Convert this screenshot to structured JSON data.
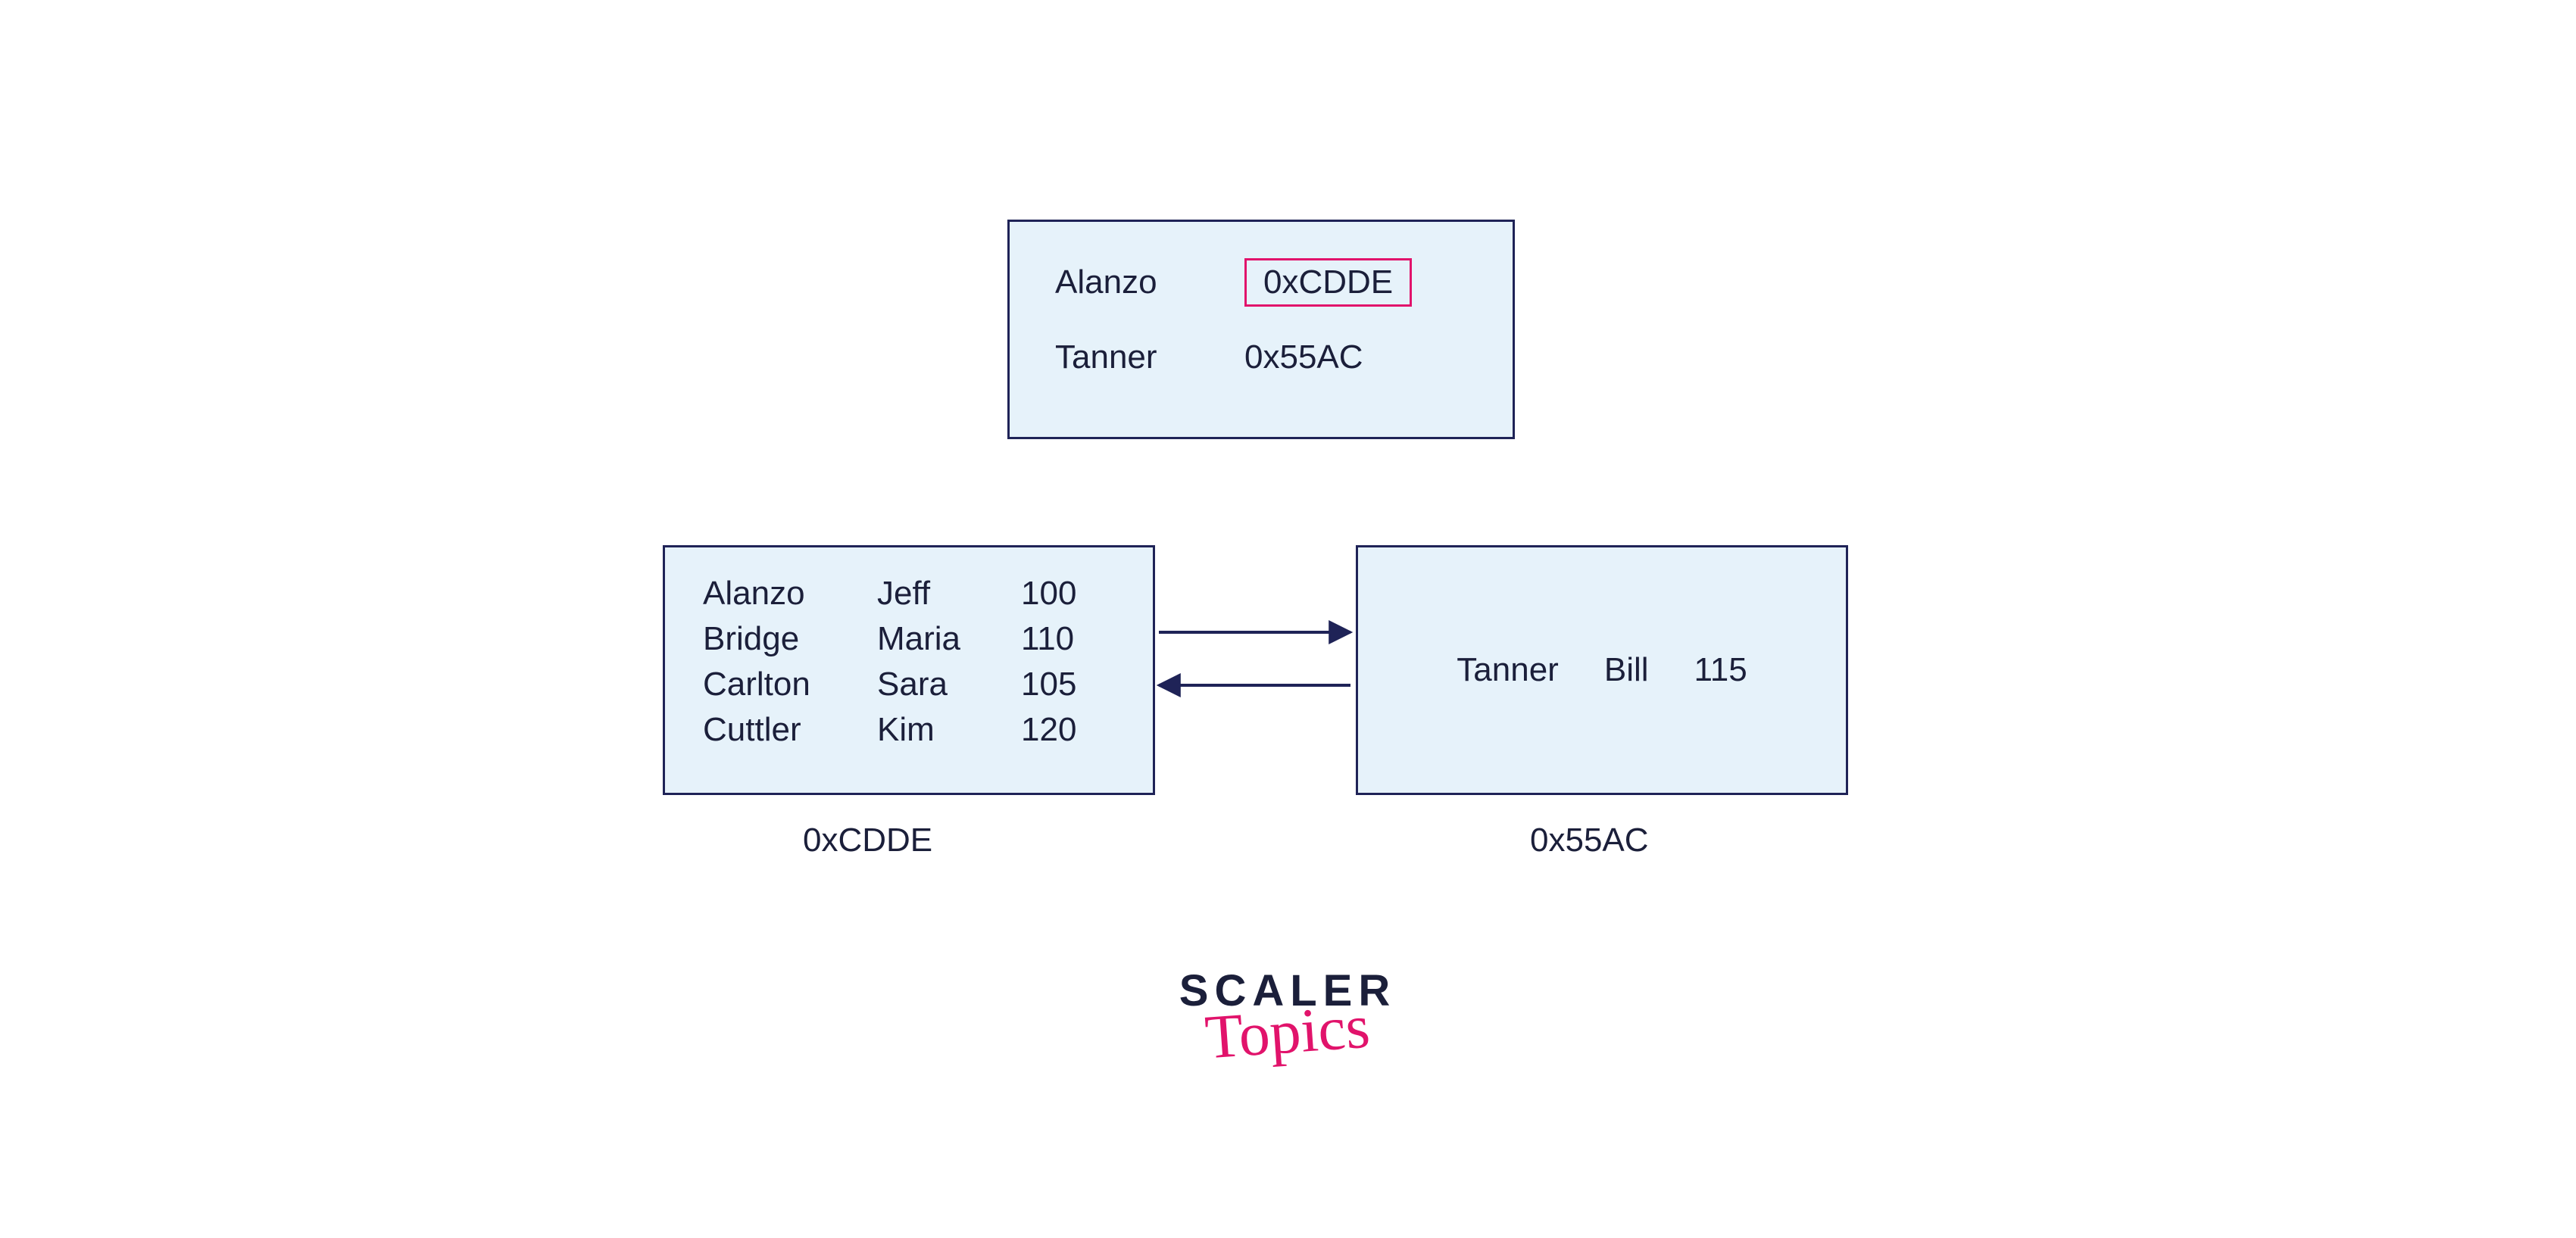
{
  "colors": {
    "box_fill": "#e6f2fa",
    "box_border": "#1f2357",
    "highlight_border": "#e1136b",
    "text": "#1b1f3a",
    "accent": "#e1136b"
  },
  "index_box": {
    "rows": [
      {
        "key": "Alanzo",
        "addr": "0xCDDE",
        "highlighted": true
      },
      {
        "key": "Tanner",
        "addr": "0x55AC",
        "highlighted": false
      }
    ]
  },
  "left_block": {
    "address_label": "0xCDDE",
    "rows": [
      {
        "last": "Alanzo",
        "first": "Jeff",
        "val": "100"
      },
      {
        "last": "Bridge",
        "first": "Maria",
        "val": "110"
      },
      {
        "last": "Carlton",
        "first": "Sara",
        "val": "105"
      },
      {
        "last": "Cuttler",
        "first": "Kim",
        "val": "120"
      }
    ]
  },
  "right_block": {
    "address_label": "0x55AC",
    "rows": [
      {
        "last": "Tanner",
        "first": "Bill",
        "val": "115"
      }
    ]
  },
  "logo": {
    "main": "SCALER",
    "sub": "Topics"
  },
  "chart_data": {
    "type": "table",
    "description": "Index structure pointing to two data blocks (linked leaf nodes)",
    "index": [
      {
        "key": "Alanzo",
        "pointer": "0xCDDE"
      },
      {
        "key": "Tanner",
        "pointer": "0x55AC"
      }
    ],
    "blocks": [
      {
        "address": "0xCDDE",
        "records": [
          {
            "last": "Alanzo",
            "first": "Jeff",
            "value": 100
          },
          {
            "last": "Bridge",
            "first": "Maria",
            "value": 110
          },
          {
            "last": "Carlton",
            "first": "Sara",
            "value": 105
          },
          {
            "last": "Cuttler",
            "first": "Kim",
            "value": 120
          }
        ]
      },
      {
        "address": "0x55AC",
        "records": [
          {
            "last": "Tanner",
            "first": "Bill",
            "value": 115
          }
        ]
      }
    ],
    "links": [
      {
        "from": "0xCDDE",
        "to": "0x55AC"
      },
      {
        "from": "0x55AC",
        "to": "0xCDDE"
      }
    ]
  }
}
